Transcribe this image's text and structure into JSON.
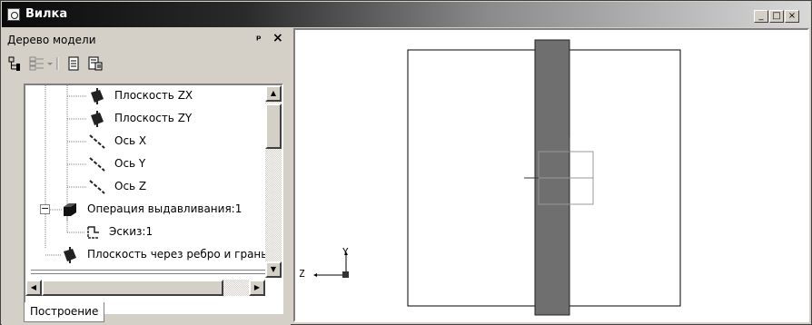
{
  "window": {
    "title": "Вилка",
    "minimize": "_",
    "maximize": "□",
    "close": "×"
  },
  "panel": {
    "title": "Дерево модели",
    "pin_glyph": "ᵖ",
    "close_glyph": "×",
    "tab_label": "Построение"
  },
  "tree": {
    "items": [
      {
        "label": "Плоскость ZX",
        "icon": "plane-icon"
      },
      {
        "label": "Плоскость ZY",
        "icon": "plane-icon"
      },
      {
        "label": "Ось X",
        "icon": "axis-icon"
      },
      {
        "label": "Ось Y",
        "icon": "axis-icon"
      },
      {
        "label": "Ось Z",
        "icon": "axis-icon"
      },
      {
        "label": "Операция выдавливания:1",
        "icon": "extrusion-icon",
        "expander": "−"
      },
      {
        "label": "Эскиз:1",
        "icon": "sketch-icon"
      },
      {
        "label": "Плоскость через ребро и грань",
        "icon": "plane-icon"
      }
    ]
  },
  "axes": {
    "y_label": "Y",
    "z_label": "Z"
  },
  "colors": {
    "part_fill": "#6f6f6f",
    "titlebar_left": "#0a0a0a",
    "titlebar_right": "#d8d8d8"
  }
}
